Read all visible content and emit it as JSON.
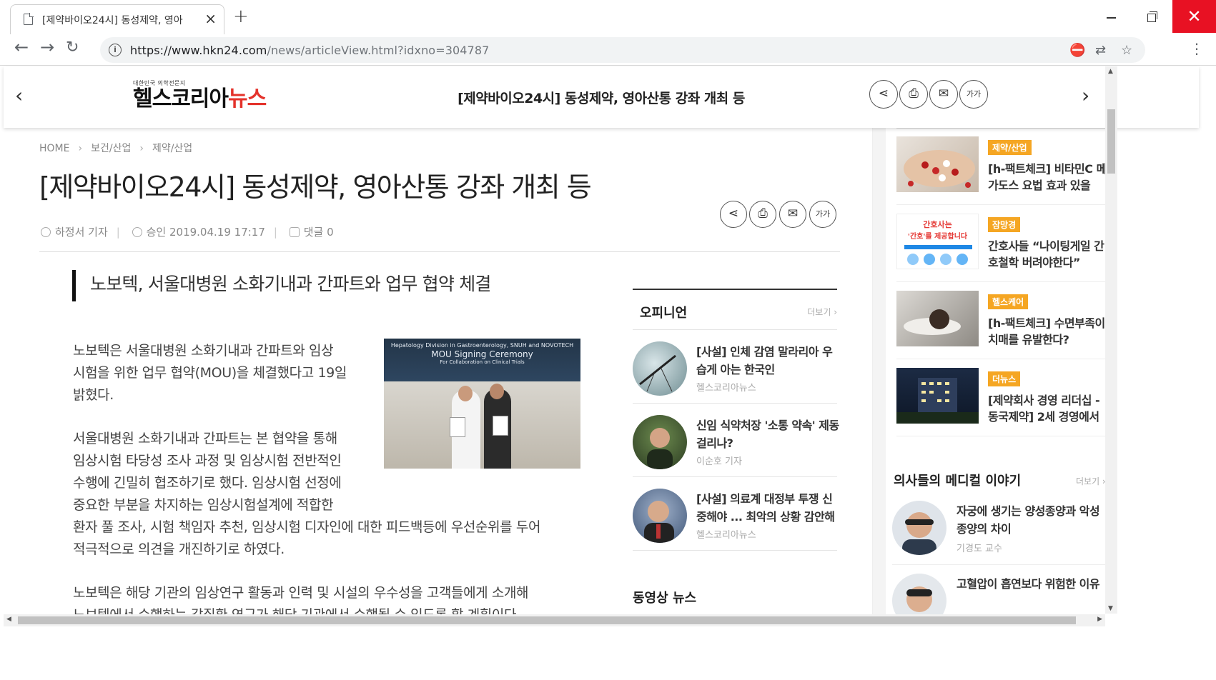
{
  "browser": {
    "tab_title": "[제약바이오24시] 동성제약, 영아",
    "tab_close": "×",
    "new_tab": "+",
    "url_host": "https://www.hkn24.com",
    "url_path": "/news/articleView.html?idxno=304787",
    "window_close": "✕"
  },
  "header": {
    "logo_sub": "대한민국 의학전문지",
    "logo_main": "헬스코리아",
    "logo_accent": "뉴스",
    "title": "[제약바이오24시] 동성제약, 영아산통 강좌 개최 등",
    "font_size_label": "가가"
  },
  "breadcrumb": [
    "HOME",
    "보건/산업",
    "제약/산업"
  ],
  "article": {
    "title": "[제약바이오24시] 동성제약, 영아산통 강좌 개최 등",
    "author": "하정서 기자",
    "approved": "승인 2019.04.19 17:17",
    "comments": "댓글 0",
    "subtitle": "노보텍, 서울대병원 소화기내과 간파트와 업무 협약 체결",
    "paragraphs": [
      [
        "노보텍은 서울대병원 소화기내과 간파트와 임상",
        "시험을 위한 업무 협약(MOU)을 체결했다고 19일",
        "밝혔다."
      ],
      [
        "서울대병원 소화기내과 간파트는 본 협약을 통해",
        "임상시험 타당성 조사 과정 및 임상시험 전반적인",
        "수행에 긴밀히 협조하기로 했다. 임상시험 선정에",
        "중요한 부분을 차지하는 임상시험설계에 적합한",
        "환자 풀 조사, 시험 책임자 추천, 임상시험 디자인에 대한 피드백등에 우선순위를 두어",
        "적극적으로 의견을 개진하기로 하였다."
      ],
      [
        "노보텍은 해당 기관의 임상연구 활동과 인력 및 시설의 우수성을 고객들에게 소개해",
        "노보텍에서 수행하는 각질환 연구가 해당 기관에서 수행될 수 있도록 할 계획이다."
      ]
    ],
    "photo": {
      "line1": "Hepatology Division in Gastroenterology, SNUH and NOVOTECH",
      "line2": "MOU Signing Ceremony",
      "line3": "For Collaboration on Clinical Trials"
    }
  },
  "opinion": {
    "heading": "오피니언",
    "more": "더보기 ›",
    "items": [
      {
        "title": "[사설] 인체 감염 말라리아 우습게 아는 한국인",
        "byline": "헬스코리아뉴스"
      },
      {
        "title": "신임 식약처장 '소통 약속' 제동걸리나?",
        "byline": "이순호 기자"
      },
      {
        "title": "[사설] 의료계 대정부 투쟁 신중해야 ... 최악의 상황 감안해",
        "byline": "헬스코리아뉴스"
      }
    ],
    "video_heading": "동영상 뉴스"
  },
  "sidebar": {
    "items": [
      {
        "category": "제약/산업",
        "title1": "[h-팩트체크] 비타민C 메",
        "title2": "가도스 요법 효과 있을"
      },
      {
        "category": "잠망경",
        "title1": "간호사들 “나이팅게일 간",
        "title2": "호철학 버려야한다”"
      },
      {
        "category": "헬스케어",
        "title1": "[h-팩트체크] 수면부족이",
        "title2": "치매를 유발한다?"
      },
      {
        "category": "더뉴스",
        "title1": "[제약회사 경영 리더십 -",
        "title2": "동국제약] 2세 경영에서"
      }
    ],
    "ad_text1": "간호사는",
    "ad_text2": "'간호'를 제공합니다",
    "medical_heading": "의사들의 메디컬 이야기",
    "medical_more": "더보기 ›",
    "medical": [
      {
        "title": "자궁에 생기는 양성종양과 악성종양의 차이",
        "byline": "기경도 교수"
      },
      {
        "title": "고혈압이 흡연보다 위험한 이유",
        "byline": ""
      }
    ]
  }
}
